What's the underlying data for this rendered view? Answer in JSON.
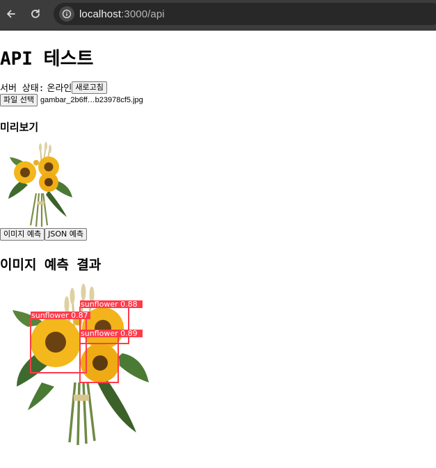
{
  "browser": {
    "url_host": "localhost",
    "url_path": ":3000/api"
  },
  "page": {
    "title": "API 테스트",
    "server_status_label": "서버 상태:",
    "server_status_value": "온라인",
    "refresh_button": "새로고침",
    "file_button": "파일 선택",
    "file_name": "gambar_2b6ff…b23978cf5.jpg",
    "preview_heading": "미리보기",
    "image_predict_button": "이미지 예측",
    "json_predict_button": "JSON 예측",
    "result_heading": "이미지 예측 결과"
  },
  "detections": [
    {
      "label": "sunflower",
      "score": "0.87"
    },
    {
      "label": "sunflower",
      "score": "0.88"
    },
    {
      "label": "sunflower",
      "score": "0.89"
    }
  ],
  "colors": {
    "box": "#ff3b4a",
    "chrome_bg": "#3c3c3c",
    "url_bg": "#282828"
  }
}
